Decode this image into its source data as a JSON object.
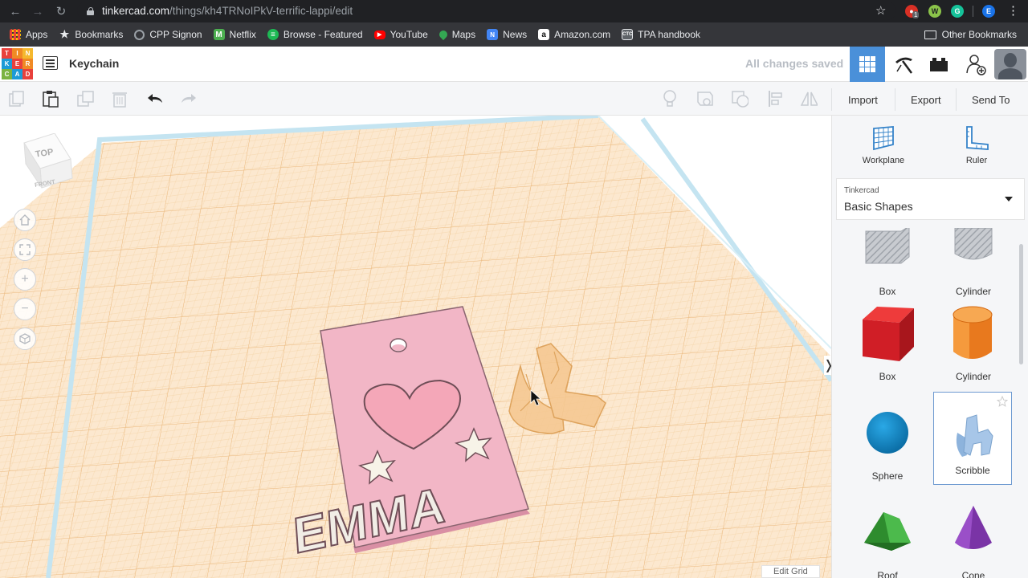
{
  "browser": {
    "url_host": "tinkercad.com",
    "url_path": "/things/kh4TRNoIPkV-terrific-lappi/edit",
    "ext_badge": "1",
    "profile_letter": "E",
    "bookmarks": [
      {
        "label": "Apps",
        "icon": "apps-grid-icon",
        "color": "#e8eaed"
      },
      {
        "label": "Bookmarks",
        "icon": "star-icon",
        "color": "#e8eaed"
      },
      {
        "label": "CPP Signon",
        "icon": "cpp-icon",
        "color": "#3c4043"
      },
      {
        "label": "Netflix",
        "icon": "netflix-icon",
        "color": "#4caf50"
      },
      {
        "label": "Browse - Featured",
        "icon": "spotify-icon",
        "color": "#1db954"
      },
      {
        "label": "YouTube",
        "icon": "youtube-icon",
        "color": "#ff0000"
      },
      {
        "label": "Maps",
        "icon": "maps-icon",
        "color": "#34a853"
      },
      {
        "label": "News",
        "icon": "news-icon",
        "color": "#4285f4"
      },
      {
        "label": "Amazon.com",
        "icon": "amazon-icon",
        "color": "#ffffff"
      },
      {
        "label": "TPA handbook",
        "icon": "tpa-icon",
        "color": "#5f6368"
      }
    ],
    "other_bookmarks": "Other Bookmarks"
  },
  "header": {
    "logo_letters": [
      "TIN",
      "KER",
      "CAD"
    ],
    "design_title": "Keychain",
    "save_status": "All changes saved"
  },
  "toolbar": {
    "import_label": "Import",
    "export_label": "Export",
    "send_to_label": "Send To"
  },
  "viewport": {
    "view_cube_top": "TOP",
    "view_cube_front": "FRONT",
    "edit_grid_label": "Edit Grid",
    "keychain_text": "EMMA"
  },
  "panel": {
    "workplane_label": "Workplane",
    "ruler_label": "Ruler",
    "library_source": "Tinkercad",
    "library_name": "Basic Shapes",
    "shapes": [
      {
        "label": "Box",
        "variant": "hole"
      },
      {
        "label": "Cylinder",
        "variant": "hole"
      },
      {
        "label": "Box",
        "variant": "solid",
        "color": "#e0222b"
      },
      {
        "label": "Cylinder",
        "variant": "solid",
        "color": "#e8791e"
      },
      {
        "label": "Sphere",
        "variant": "solid",
        "color": "#1593d0"
      },
      {
        "label": "Scribble",
        "variant": "solid",
        "color": "#93b8de",
        "selected": true
      },
      {
        "label": "Roof",
        "variant": "solid",
        "color": "#3aa53a"
      },
      {
        "label": "Cone",
        "variant": "solid",
        "color": "#7d3aa5"
      }
    ]
  },
  "colors": {
    "accent": "#4a90d9",
    "grid": "#f6c88c",
    "keychain": "#f2b6c6"
  }
}
